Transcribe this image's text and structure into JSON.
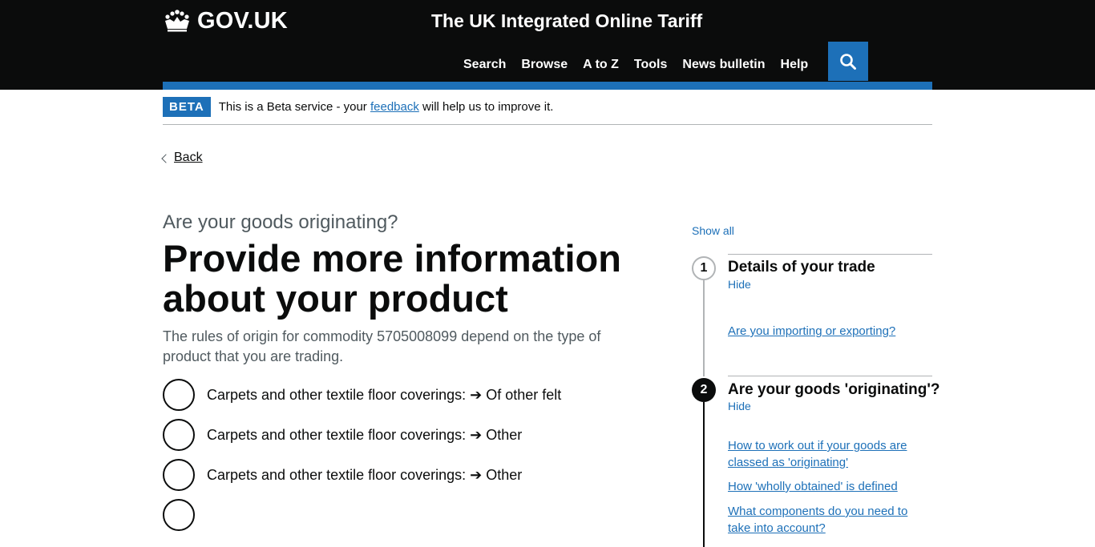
{
  "header": {
    "logo_text": "GOV.UK",
    "service_name": "The UK Integrated Online Tariff",
    "nav": [
      "Search",
      "Browse",
      "A to Z",
      "Tools",
      "News bulletin",
      "Help"
    ]
  },
  "phase": {
    "tag": "BETA",
    "text_before": "This is a Beta service - your ",
    "link": "feedback",
    "text_after": " will help us to improve it."
  },
  "back_label": "Back",
  "main": {
    "caption": "Are your goods originating?",
    "heading": "Provide more information about your product",
    "lead": "The rules of origin for commodity 5705008099 depend on the type of product that you are trading.",
    "options": [
      "Carpets and other textile floor coverings: ➔ Of other felt",
      "Carpets and other textile floor coverings: ➔ Other",
      "Carpets and other textile floor coverings: ➔ Other",
      ""
    ]
  },
  "sidebar": {
    "show_all": "Show all",
    "steps": [
      {
        "number": "1",
        "title": "Details of your trade",
        "toggle": "Hide",
        "links": [
          "Are you importing or exporting?"
        ]
      },
      {
        "number": "2",
        "title": "Are your goods 'originating'?",
        "toggle": "Hide",
        "links": [
          "How to work out if your goods are classed as 'originating'",
          "How 'wholly obtained' is defined",
          "What components do you need to take into account?"
        ]
      }
    ]
  },
  "colors": {
    "header_bg": "#0b0c0c",
    "brand_blue": "#1d70b8",
    "secondary_text": "#505a5f"
  }
}
